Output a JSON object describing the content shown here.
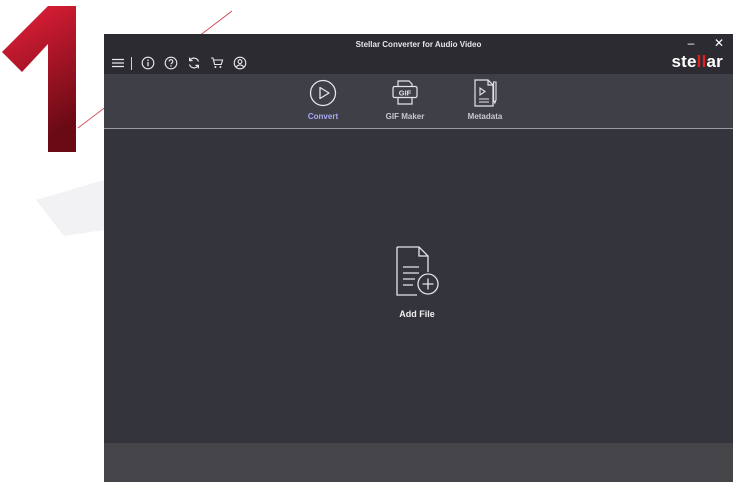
{
  "window": {
    "title": "Stellar Converter for Audio Video",
    "minimize": "–",
    "close": "✕"
  },
  "toolbar": {
    "icons": [
      "menu-icon",
      "info-icon",
      "help-icon",
      "refresh-icon",
      "cart-icon",
      "account-icon"
    ]
  },
  "brand": {
    "logo_pre": "ste",
    "logo_mid": "ll",
    "logo_post": "ar",
    "accent": "#e02020"
  },
  "tabs": [
    {
      "label": "Convert",
      "icon": "play-circle-icon",
      "active": true
    },
    {
      "label": "GIF Maker",
      "icon": "gif-icon",
      "active": false
    },
    {
      "label": "Metadata",
      "icon": "metadata-icon",
      "active": false
    }
  ],
  "main": {
    "add_file_label": "Add File",
    "add_file_icon": "add-file-icon"
  },
  "colors": {
    "titlebar": "#2b2b31",
    "tabbar": "#3f3f47",
    "main": "#34343c",
    "active_tab": "#a9a9f5",
    "statusbar": "#444449"
  }
}
